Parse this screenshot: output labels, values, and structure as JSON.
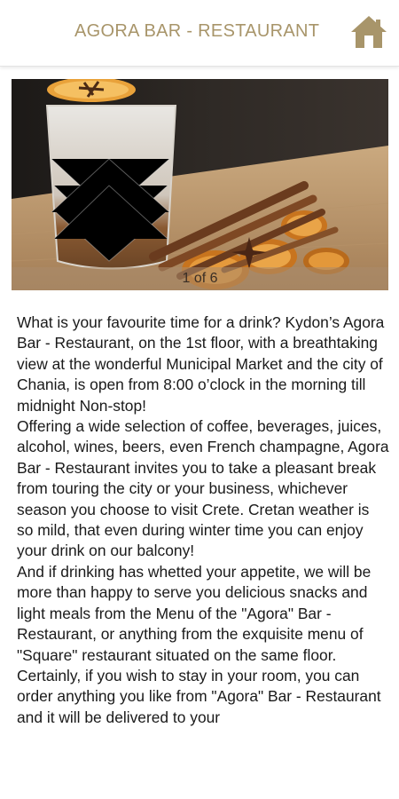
{
  "header": {
    "title": "AGORA BAR - RESTAURANT",
    "home_icon": "home-icon",
    "accent_color": "#a8956a"
  },
  "carousel": {
    "counter": "1 of 6",
    "current": 1,
    "total": 6
  },
  "content": {
    "paragraphs": [
      "What is your favourite time for a drink? Kydon’s Agora Bar - Restaurant, on the 1st floor, with a breathtaking view at the wonderful Municipal Market and the city of Chania, is open from 8:00 o’clock in the morning till midnight Non-stop!",
      "Offering a wide selection of coffee, beverages, juices, alcohol, wines, beers, even French champagne, Agora Bar - Restaurant invites you to take a pleasant break from touring the city or your business, whichever season you choose to visit Crete. Cretan weather is so mild, that even during winter time you can enjoy your drink on our balcony!",
      "And if drinking has whetted your appetite, we will be more than happy to serve you delicious snacks and light meals from the Menu of the \"Agora\" Bar - Restaurant, or anything from the exquisite menu of \"Square\" restaurant situated on the same floor.",
      "Certainly, if you wish to stay in your room, you can order anything you like from \"Agora\" Bar - Restaurant and it will be delivered to your"
    ]
  }
}
